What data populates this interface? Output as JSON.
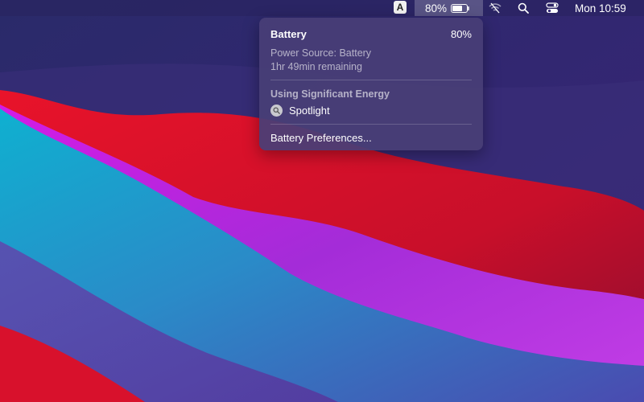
{
  "menubar": {
    "input_source": "A",
    "battery_percent": "80%",
    "battery_level": 0.8,
    "wifi_icon": "wifi-off-icon",
    "search_icon": "search-icon",
    "control_center_icon": "control-center-icon",
    "clock": "Mon 10:59"
  },
  "battery_menu": {
    "title": "Battery",
    "percent": "80%",
    "power_source": "Power Source: Battery",
    "remaining": "1hr 49min remaining",
    "section_title": "Using Significant Energy",
    "apps": [
      {
        "name": "Spotlight",
        "icon": "spotlight-icon"
      }
    ],
    "preferences_label": "Battery Preferences..."
  },
  "colors": {
    "background": "#2c2465",
    "red": "#e0142b",
    "magenta": "#cf1fe8",
    "cyan": "#11a6c9",
    "menu_bg": "#483e76"
  }
}
